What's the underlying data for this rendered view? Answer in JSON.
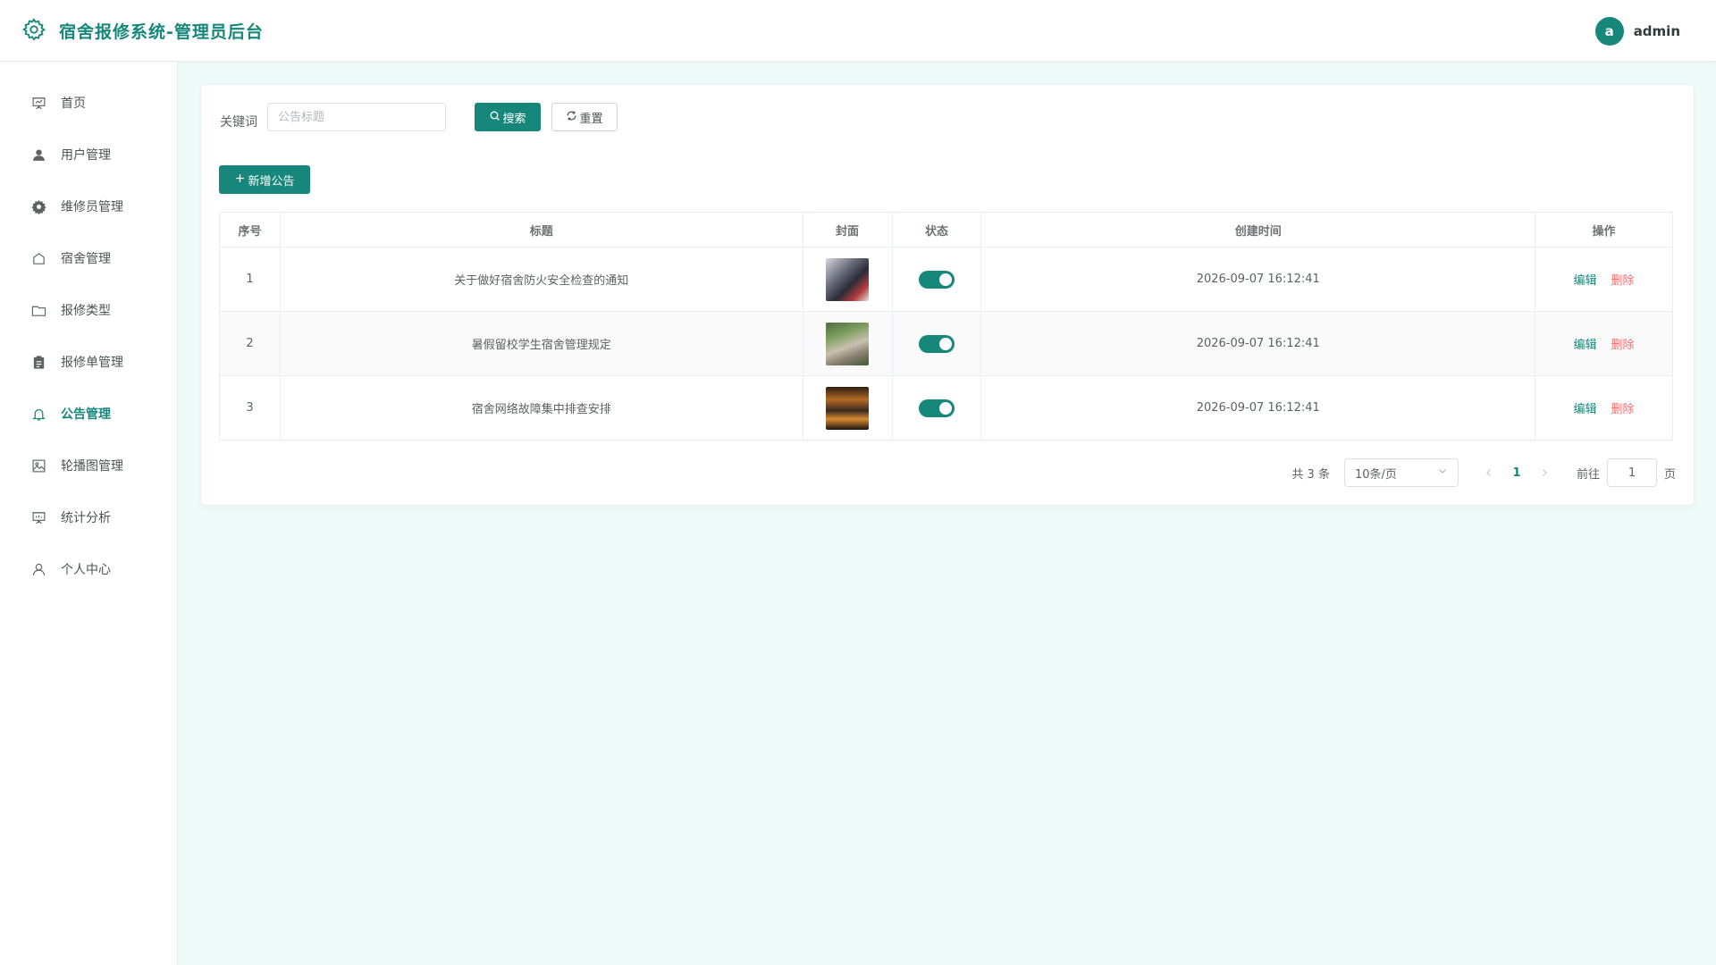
{
  "header": {
    "title": "宿舍报修系统-管理员后台",
    "avatar_letter": "a",
    "username": "admin",
    "brand_color": "#16877a"
  },
  "sidebar": {
    "items": [
      {
        "label": "首页",
        "icon": "presentation-icon",
        "active": false
      },
      {
        "label": "用户管理",
        "icon": "user-filled-icon",
        "active": false
      },
      {
        "label": "维修员管理",
        "icon": "gear-icon",
        "active": false
      },
      {
        "label": "宿舍管理",
        "icon": "house-icon",
        "active": false
      },
      {
        "label": "报修类型",
        "icon": "folder-icon",
        "active": false
      },
      {
        "label": "报修单管理",
        "icon": "clipboard-icon",
        "active": false
      },
      {
        "label": "公告管理",
        "icon": "bell-icon",
        "active": true
      },
      {
        "label": "轮播图管理",
        "icon": "picture-icon",
        "active": false
      },
      {
        "label": "统计分析",
        "icon": "data-board-icon",
        "active": false
      },
      {
        "label": "个人中心",
        "icon": "user-outline-icon",
        "active": false
      }
    ]
  },
  "search": {
    "label": "关键词",
    "placeholder": "公告标题",
    "value": "",
    "search_label": "搜索",
    "reset_label": "重置"
  },
  "toolbar": {
    "add_label": "新增公告"
  },
  "table": {
    "columns": [
      "序号",
      "标题",
      "封面",
      "状态",
      "创建时间",
      "操作"
    ],
    "rows": [
      {
        "index": "1",
        "title": "关于做好宿舍防火安全检查的通知",
        "enabled": true,
        "created": "2026-09-07 16:12:41"
      },
      {
        "index": "2",
        "title": "暑假留校学生宿舍管理规定",
        "enabled": true,
        "created": "2026-09-07 16:12:41"
      },
      {
        "index": "3",
        "title": "宿舍网络故障集中排查安排",
        "enabled": true,
        "created": "2026-09-07 16:12:41"
      }
    ],
    "edit_label": "编辑",
    "delete_label": "删除"
  },
  "pagination": {
    "total_text": "共 3 条",
    "page_size": "10条/页",
    "current_page": "1",
    "goto_label": "前往",
    "goto_value": "1",
    "page_suffix": "页"
  }
}
